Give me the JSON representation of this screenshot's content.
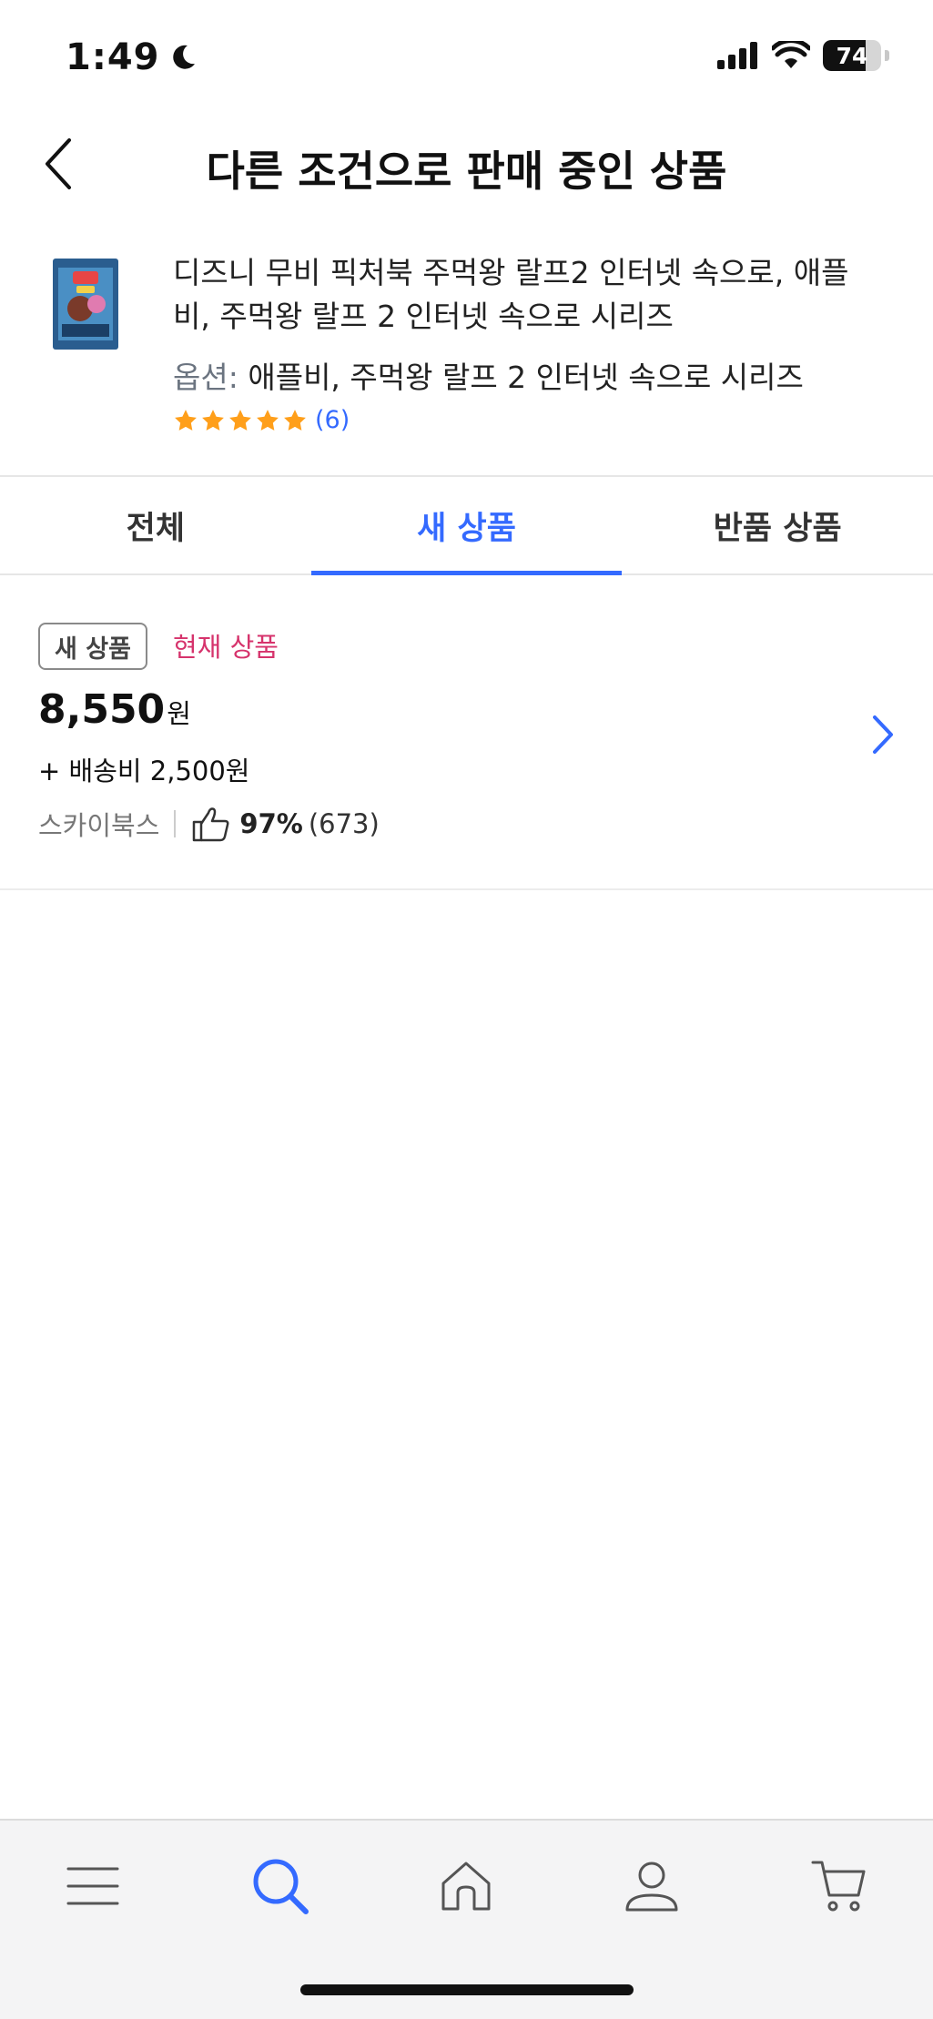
{
  "status_bar": {
    "time": "1:49",
    "battery": "74",
    "battery_level_percent": 74
  },
  "header": {
    "title": "다른 조건으로 판매 중인 상품"
  },
  "product": {
    "name": "디즈니 무비 픽처북 주먹왕 랄프2 인터넷 속으로, 애플비, 주먹왕 랄프 2 인터넷 속으로 시리즈",
    "option_label": "옵션:",
    "option_value": "애플비, 주먹왕 랄프 2 인터넷 속으로 시리즈",
    "rating_stars": 5,
    "review_count": "(6)"
  },
  "tabs": [
    {
      "label": "전체",
      "active": false
    },
    {
      "label": "새 상품",
      "active": true
    },
    {
      "label": "반품 상품",
      "active": false
    }
  ],
  "offer": {
    "badge": "새 상품",
    "current_tag": "현재 상품",
    "price": "8,550",
    "price_unit": "원",
    "shipping": "+ 배송비 2,500원",
    "seller": "스카이북스",
    "positive_rate": "97%",
    "rating_count": "(673)"
  },
  "bottom_nav": {
    "items": [
      "menu-icon",
      "search-icon",
      "home-icon",
      "profile-icon",
      "cart-icon"
    ],
    "active": "search-icon"
  },
  "colors": {
    "accent": "#346aff",
    "current_tag": "#d6336c",
    "star": "#ff9f1a"
  }
}
